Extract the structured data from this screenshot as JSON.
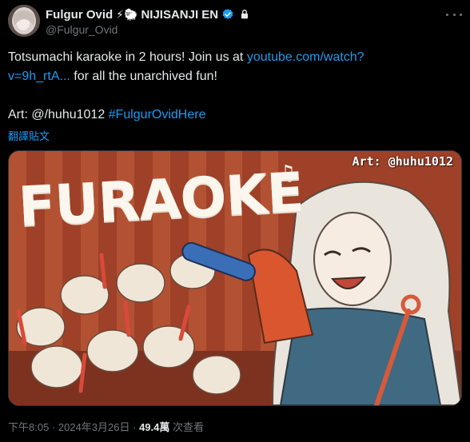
{
  "author": {
    "display_name": "Fulgur Ovid",
    "name_suffix_emoji": "⚡🐑",
    "org_tag": "NIJISANJI EN",
    "handle": "@Fulgur_Ovid"
  },
  "tweet": {
    "line1_prefix": "Totsumachi karaoke in 2 hours! Join us at ",
    "link_text": "youtube.com/watch?v=9h_rtA...",
    "line1_suffix": " for all the unarchived fun!",
    "art_prefix": "Art: @/huhu1012 ",
    "hashtag": "#FulgurOvidHere",
    "translate_label": "翻譯貼文"
  },
  "media": {
    "credit": "Art: @huhu1012",
    "title": "FURAOKE"
  },
  "meta": {
    "time": "下午8:05",
    "sep": " · ",
    "date": "2024年3月26日",
    "views_count": "49.4萬",
    "views_label": " 次查看"
  },
  "colors": {
    "accent": "#1d9bf0",
    "background": "#000000",
    "muted": "#71767b",
    "verified": "#1d9bf0"
  }
}
